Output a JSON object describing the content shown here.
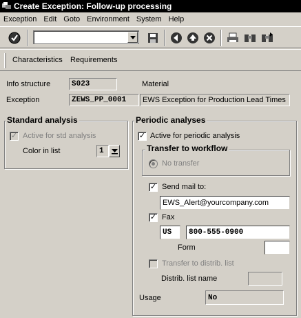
{
  "window": {
    "title": "Create Exception: Follow-up processing"
  },
  "menu": [
    "Exception",
    "Edit",
    "Goto",
    "Environment",
    "System",
    "Help"
  ],
  "toolbar": {
    "command_value": "",
    "icons": [
      "enter-check-icon",
      "save-icon",
      "back-icon",
      "exit-icon",
      "cancel-icon",
      "print-icon",
      "find-icon",
      "find-next-icon"
    ]
  },
  "app_toolbar": {
    "characteristics_label": "Characteristics",
    "requirements_label": "Requirements"
  },
  "header": {
    "info_structure_label": "Info structure",
    "info_structure_value": "S023",
    "material_label": "Material",
    "exception_label": "Exception",
    "exception_value": "ZEWS_PP_0001",
    "exception_description": "EWS Exception for Production Lead Times"
  },
  "standard_analysis": {
    "title": "Standard analysis",
    "active_label": "Active for std analysis",
    "active_checked": true,
    "color_label": "Color in list",
    "color_value": "1"
  },
  "periodic_analyses": {
    "title": "Periodic analyses",
    "active_label": "Active for periodic analysis",
    "active_checked": true,
    "workflow": {
      "title": "Transfer to workflow",
      "option_label": "No transfer"
    },
    "send_mail_label": "Send mail to:",
    "send_mail_checked": true,
    "email": "EWS_Alert@yourcompany.com",
    "fax_label": "Fax",
    "fax_checked": true,
    "fax_country": "US",
    "fax_number": "800-555-0900",
    "form_label": "Form",
    "form_value": "",
    "distrib_label": "Transfer to distrib. list",
    "distrib_checked": false,
    "distrib_name_label": "Distrib. list name",
    "distrib_name_value": "",
    "usage_label": "Usage",
    "usage_value": "No"
  }
}
